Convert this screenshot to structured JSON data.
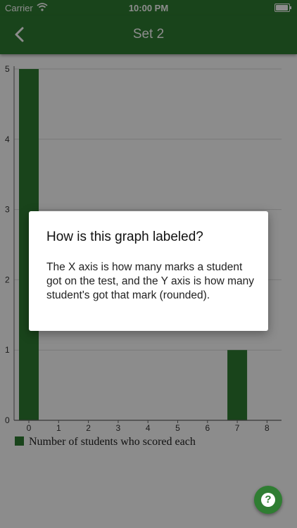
{
  "status_bar": {
    "carrier": "Carrier",
    "time": "10:00 PM"
  },
  "nav": {
    "title": "Set 2",
    "back_icon": "chevron-left-icon"
  },
  "colors": {
    "primary": "#2f7d32",
    "bar": "#2e7d32"
  },
  "chart_data": {
    "type": "bar",
    "categories": [
      "0",
      "1",
      "2",
      "3",
      "4",
      "5",
      "6",
      "7",
      "8"
    ],
    "series": [
      {
        "name": "Number of students who scored each",
        "values": [
          5,
          0,
          0,
          0,
          0,
          0,
          0,
          1,
          0
        ]
      }
    ],
    "y_ticks": [
      "0",
      "1",
      "2",
      "3",
      "4",
      "5"
    ],
    "ylim": [
      0,
      5
    ],
    "grid": true,
    "legend": "bottom-left"
  },
  "dialog": {
    "title": "How is this graph labeled?",
    "body": "The X axis is how many marks a student got on the test, and the Y axis is how many student's got that mark (rounded)."
  },
  "fab": {
    "label": "?",
    "icon": "help-icon"
  }
}
